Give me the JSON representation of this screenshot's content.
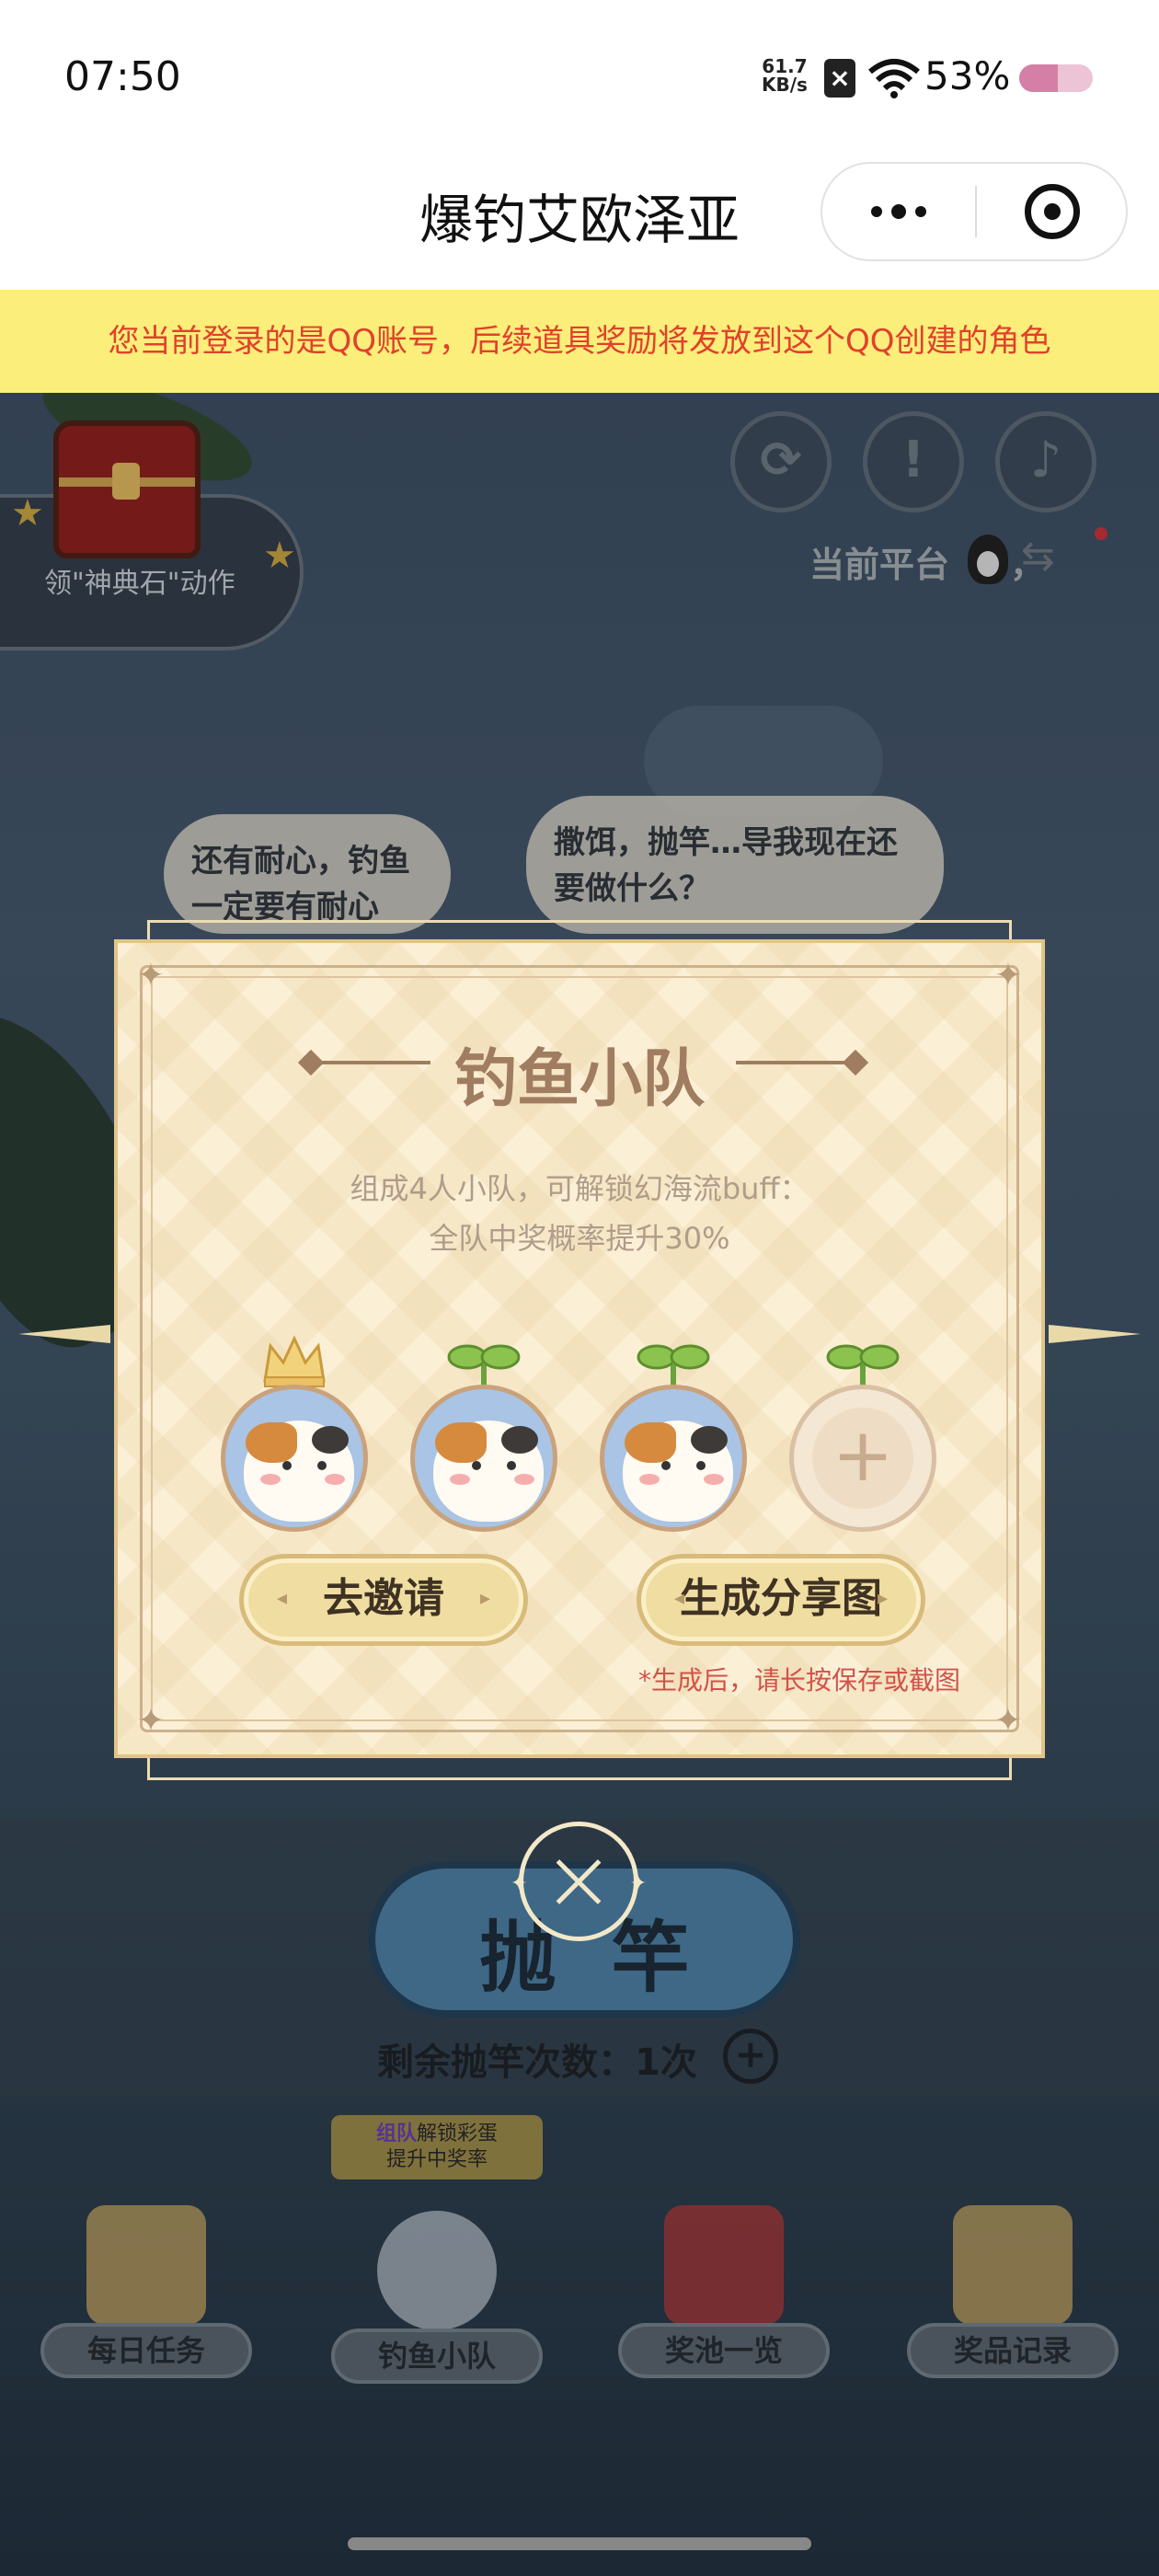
{
  "status_bar": {
    "time": "07:50",
    "net_speed_value": "61.7",
    "net_speed_unit": "KB/s",
    "battery_pct": "53%",
    "battery_level": 0.53
  },
  "title_bar": {
    "title": "爆钓艾欧泽亚"
  },
  "notice": "您当前登录的是QQ账号，后续道具奖励将发放到这个QQ创建的角色",
  "game": {
    "chest_label": "领\"神典石\"动作",
    "platform_label": "当前平台",
    "platform_sep": "，",
    "bubble_left": "还有耐心，钓鱼一定要有耐心",
    "bubble_right": "撒饵，抛竿…导我现在还要做什么？",
    "cast_label": "抛竿",
    "remaining": "剩余抛竿次数：1次",
    "tag_line1_a": "组队",
    "tag_line1_b": "解锁彩蛋",
    "tag_line2": "提升中奖率",
    "bottom_nav": [
      {
        "label": "每日任务",
        "icon": "notepad-icon"
      },
      {
        "label": "钓鱼小队",
        "icon": "team-cat-icon"
      },
      {
        "label": "奖池一览",
        "icon": "gift-box-icon"
      },
      {
        "label": "奖品记录",
        "icon": "crown-book-icon"
      }
    ]
  },
  "modal": {
    "title": "钓鱼小队",
    "desc_line1": "组成4人小队，可解锁幻海流buff：",
    "desc_line2": "全队中奖概率提升30%",
    "members": [
      {
        "type": "leader",
        "icon": "crown-icon"
      },
      {
        "type": "member",
        "icon": "sprout-icon"
      },
      {
        "type": "member",
        "icon": "sprout-icon"
      },
      {
        "type": "empty",
        "icon": "sprout-icon",
        "plus": "+"
      }
    ],
    "invite_label": "去邀请",
    "share_label": "生成分享图",
    "hint": "*生成后，请长按保存或截图"
  },
  "colors": {
    "notice_bg": "#fcee7a",
    "notice_text": "#e0412c",
    "modal_bg": "#fbf0d6",
    "modal_title": "#a07c60",
    "hint_red": "#d0534a"
  }
}
